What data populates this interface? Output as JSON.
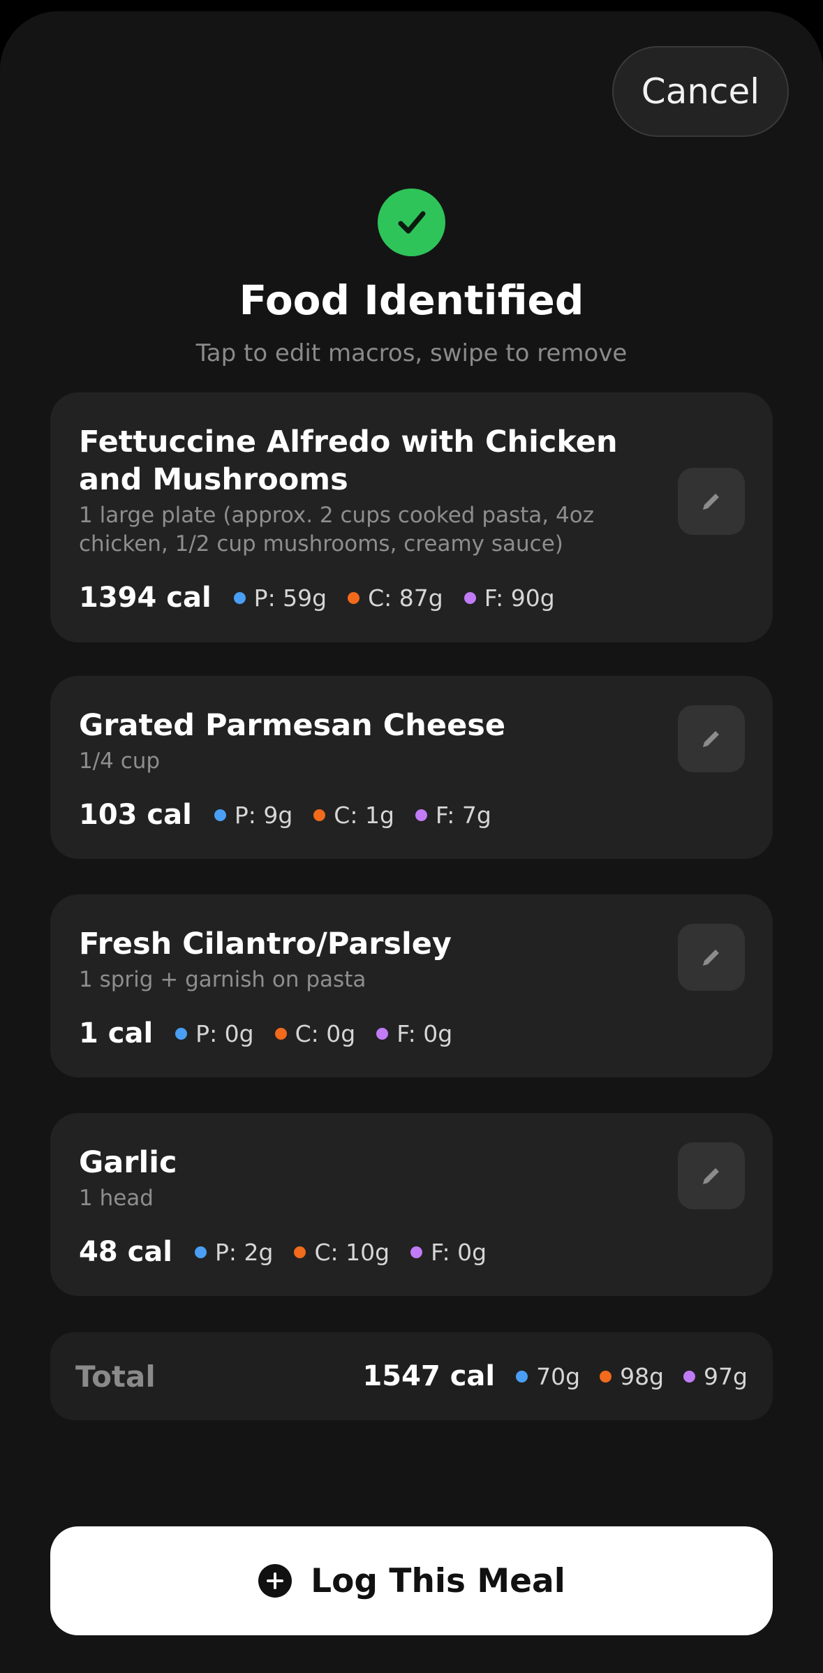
{
  "header": {
    "cancel_label": "Cancel"
  },
  "status": {
    "icon": "checkmark-icon",
    "title": "Food Identified",
    "subtitle": "Tap to edit macros, swipe to remove"
  },
  "colors": {
    "protein": "#4a9ff5",
    "carbs": "#f26a1b",
    "fat": "#c17bf5",
    "success": "#2ec45a"
  },
  "foods": [
    {
      "name": "Fettuccine Alfredo with Chicken and Mushrooms",
      "portion": "1 large plate (approx. 2 cups cooked pasta, 4oz chicken, 1/2 cup mushrooms, creamy sauce)",
      "calories": "1394 cal",
      "protein": "P: 59g",
      "carbs": "C: 87g",
      "fat": "F: 90g"
    },
    {
      "name": "Grated Parmesan Cheese",
      "portion": "1/4 cup",
      "calories": "103 cal",
      "protein": "P: 9g",
      "carbs": "C: 1g",
      "fat": "F: 7g"
    },
    {
      "name": "Fresh Cilantro/Parsley",
      "portion": "1 sprig + garnish on pasta",
      "calories": "1 cal",
      "protein": "P: 0g",
      "carbs": "C: 0g",
      "fat": "F: 0g"
    },
    {
      "name": "Garlic",
      "portion": "1 head",
      "calories": "48 cal",
      "protein": "P: 2g",
      "carbs": "C: 10g",
      "fat": "F: 0g"
    }
  ],
  "total": {
    "label": "Total",
    "calories": "1547 cal",
    "protein": "70g",
    "carbs": "98g",
    "fat": "97g"
  },
  "footer": {
    "log_label": "Log This Meal",
    "log_icon": "plus-circle-icon"
  }
}
